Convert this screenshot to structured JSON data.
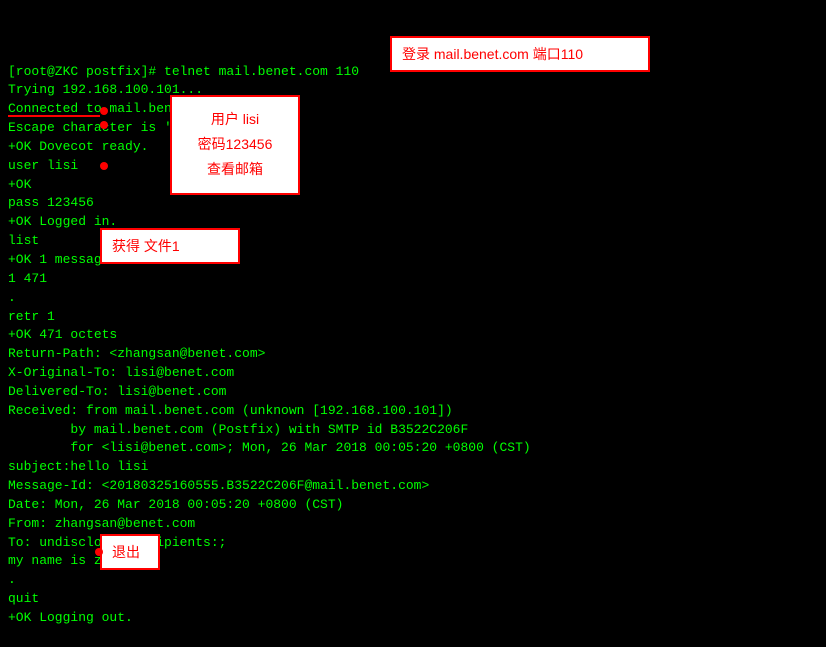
{
  "terminal": {
    "lines": [
      "[root@ZKC postfix]# telnet mail.benet.com 110",
      "Trying 192.168.100.101...",
      "Connected to mail.benet.com.",
      "Escape character is '^]'.",
      "+OK Dovecot ready.",
      "user lisi",
      "+OK",
      "pass 123456",
      "+OK Logged in.",
      "list",
      "+OK 1 messages:",
      "1 471",
      ".",
      "retr 1",
      "+OK 471 octets",
      "Return-Path: <zhangsan@benet.com>",
      "X-Original-To: lisi@benet.com",
      "Delivered-To: lisi@benet.com",
      "Received: from mail.benet.com (unknown [192.168.100.101])",
      "        by mail.benet.com (Postfix) with SMTP id B3522C206F",
      "        for <lisi@benet.com>; Mon, 26 Mar 2018 00:05:20 +0800 (CST)",
      "subject:hello lisi",
      "Message-Id: <20180325160555.B3522C206F@mail.benet.com>",
      "Date: Mon, 26 Mar 2018 00:05:20 +0800 (CST)",
      "From: zhangsan@benet.com",
      "To: undisclosed-recipients:;",
      "",
      "my name is zhangsan",
      ".",
      "quit",
      "+OK Logging out."
    ]
  },
  "annotations": {
    "login_label": "登录 mail.benet.com 端口110",
    "user_label": "用户 lisi",
    "password_label": "密码123456",
    "mailbox_label": "查看邮箱",
    "getfile_label": "获得 文件1",
    "quit_label": "退出"
  }
}
